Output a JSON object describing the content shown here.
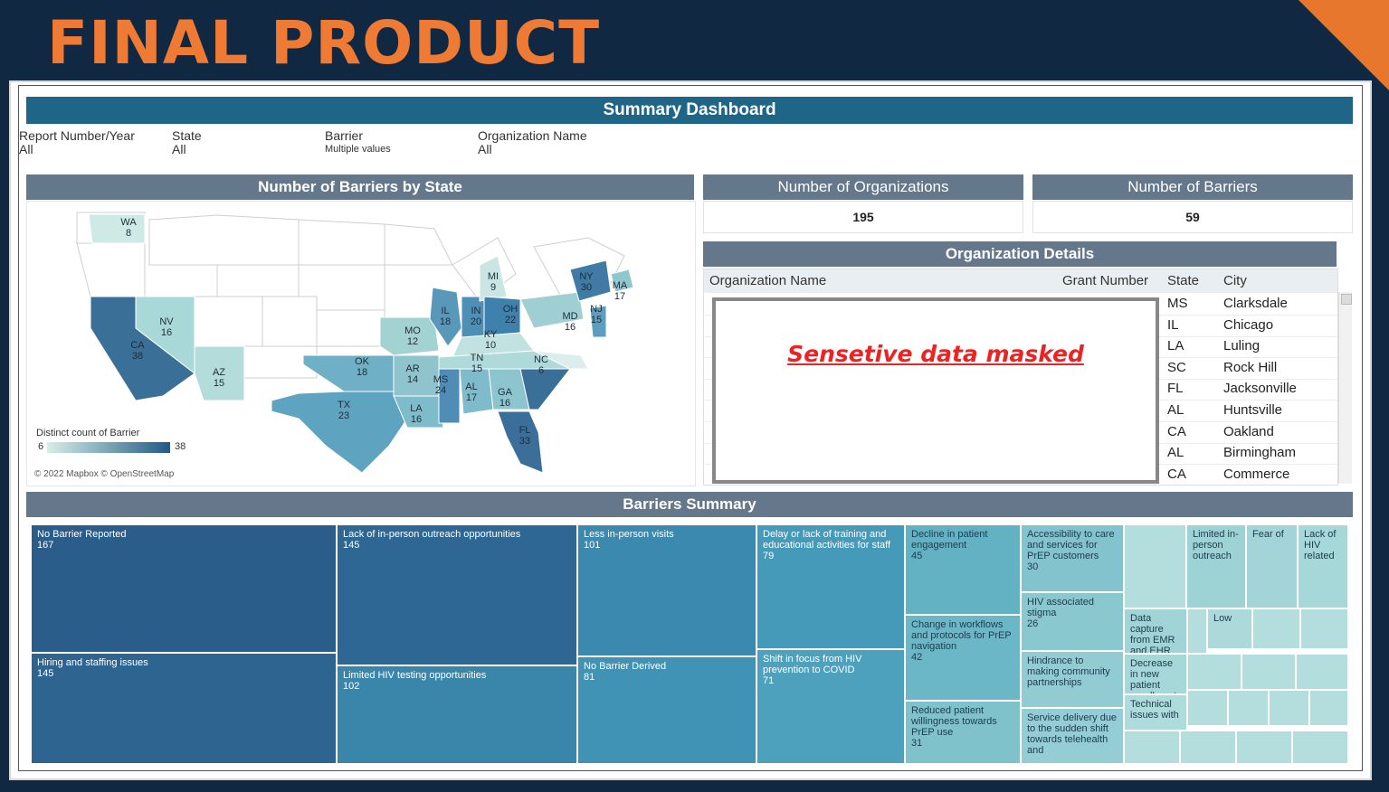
{
  "slide": {
    "title": "FINAL PRODUCT"
  },
  "dashboard": {
    "title": "Summary Dashboard",
    "filters": [
      {
        "label": "Report Number/Year",
        "value": "All"
      },
      {
        "label": "State",
        "value": "All"
      },
      {
        "label": "Barrier",
        "value": "Multiple values"
      },
      {
        "label": "Organization Name",
        "value": "All"
      }
    ]
  },
  "map": {
    "title": "Number of Barriers by State",
    "legend_title": "Distinct count of Barrier",
    "legend_min": "6",
    "legend_max": "38",
    "credit": "© 2022 Mapbox © OpenStreetMap",
    "states": [
      {
        "code": "WA",
        "value": "8"
      },
      {
        "code": "NV",
        "value": "16"
      },
      {
        "code": "CA",
        "value": "38"
      },
      {
        "code": "AZ",
        "value": "15"
      },
      {
        "code": "OK",
        "value": "18"
      },
      {
        "code": "TX",
        "value": "23"
      },
      {
        "code": "MO",
        "value": "12"
      },
      {
        "code": "AR",
        "value": "14"
      },
      {
        "code": "LA",
        "value": "16"
      },
      {
        "code": "MS",
        "value": "24"
      },
      {
        "code": "IL",
        "value": "18"
      },
      {
        "code": "IN",
        "value": "20"
      },
      {
        "code": "MI",
        "value": "9"
      },
      {
        "code": "OH",
        "value": "22"
      },
      {
        "code": "KY",
        "value": "10"
      },
      {
        "code": "TN",
        "value": "15"
      },
      {
        "code": "AL",
        "value": "17"
      },
      {
        "code": "GA",
        "value": "16"
      },
      {
        "code": "FL",
        "value": "33"
      },
      {
        "code": "NC",
        "value": "6"
      },
      {
        "code": "MD",
        "value": "16"
      },
      {
        "code": "NJ",
        "value": "15"
      },
      {
        "code": "NY",
        "value": "30"
      },
      {
        "code": "MA",
        "value": "17"
      }
    ]
  },
  "kpis": [
    {
      "label": "Number of Organizations",
      "value": "195"
    },
    {
      "label": "Number of Barriers",
      "value": "59"
    }
  ],
  "org_details": {
    "title": "Organization Details",
    "columns": [
      "Organization Name",
      "Grant Number",
      "State",
      "City"
    ],
    "rows": [
      {
        "state": "MS",
        "city": "Clarksdale"
      },
      {
        "state": "IL",
        "city": "Chicago"
      },
      {
        "state": "LA",
        "city": "Luling"
      },
      {
        "state": "SC",
        "city": "Rock Hill"
      },
      {
        "state": "FL",
        "city": "Jacksonville"
      },
      {
        "state": "AL",
        "city": "Huntsville"
      },
      {
        "state": "CA",
        "city": "Oakland"
      },
      {
        "state": "AL",
        "city": "Birmingham"
      },
      {
        "state": "CA",
        "city": "Commerce"
      }
    ],
    "mask_text": "Sensetive data masked"
  },
  "barriers": {
    "title": "Barriers Summary",
    "tiles": [
      {
        "label": "No Barrier Reported",
        "value": "167",
        "color": "#2b5d8a"
      },
      {
        "label": "Hiring and staffing issues",
        "value": "145",
        "color": "#2e6490"
      },
      {
        "label": "Lack of in-person outreach opportunities",
        "value": "145",
        "color": "#2e6793"
      },
      {
        "label": "Limited HIV testing opportunities",
        "value": "102",
        "color": "#3a86ab"
      },
      {
        "label": "Less in-person visits",
        "value": "101",
        "color": "#3b89ae"
      },
      {
        "label": "No Barrier Derived",
        "value": "81",
        "color": "#4193b5"
      },
      {
        "label": "Delay or lack of training and educational activities for staff",
        "value": "79",
        "color": "#4599b9"
      },
      {
        "label": "Shift in focus from HIV prevention to COVID",
        "value": "71",
        "color": "#4ea1bd"
      },
      {
        "label": "Decline in patient engagement",
        "value": "45",
        "color": "#63b2c4"
      },
      {
        "label": "Change in workflows and protocols for PrEP navigation",
        "value": "42",
        "color": "#6cb7c7"
      },
      {
        "label": "Reduced patient willingness towards PrEP use",
        "value": "31",
        "color": "#7fc2cc"
      },
      {
        "label": "Accessibility to care and services for PrEP customers",
        "value": "30",
        "color": "#82c3cd"
      },
      {
        "label": "HIV associated stigma",
        "value": "26",
        "color": "#8ac8cf"
      },
      {
        "label": "Hindrance to making community partnerships",
        "value": "",
        "color": "#92ccd2"
      },
      {
        "label": "Service delivery due to the sudden shift towards telehealth and",
        "value": "",
        "color": "#94cdd3"
      },
      {
        "label": "Limited in-person outreach",
        "value": "",
        "color": "#9ed3d6"
      },
      {
        "label": "Fear of",
        "value": "",
        "color": "#a3d5d8"
      },
      {
        "label": "Lack of HIV related",
        "value": "",
        "color": "#a6d7d9"
      },
      {
        "label": "Data capture from EMR and EHR",
        "value": "",
        "color": "#a0d4d7"
      },
      {
        "label": "Low",
        "value": "",
        "color": "#acdadb"
      },
      {
        "label": "Decrease in new patient enrollment",
        "value": "",
        "color": "#a7d8d9"
      },
      {
        "label": "Technical issues with",
        "value": "",
        "color": "#aedbdc"
      }
    ]
  }
}
